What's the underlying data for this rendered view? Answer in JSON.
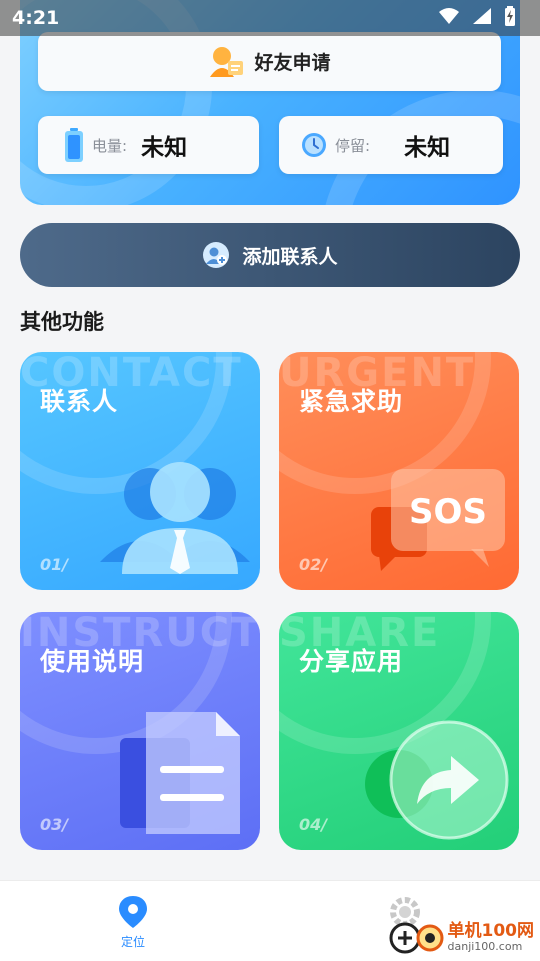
{
  "status_bar": {
    "time": "4:21"
  },
  "hero": {
    "friend_request_label": "好友申请",
    "battery": {
      "label": "电量:",
      "value": "未知"
    },
    "stay": {
      "label": "停留:",
      "value": "未知"
    }
  },
  "add_contact_label": "添加联系人",
  "section_title": "其他功能",
  "features": [
    {
      "title": "联系人",
      "en": "CONTACT",
      "num": "01/"
    },
    {
      "title": "紧急求助",
      "en": "URGENT",
      "num": "02/",
      "badge": "SOS"
    },
    {
      "title": "使用说明",
      "en": "INSTRUCTION",
      "num": "03/"
    },
    {
      "title": "分享应用",
      "en": "SHARE",
      "num": "04/"
    }
  ],
  "nav": {
    "locate_label": "定位"
  },
  "watermark": {
    "cn": "单机100网",
    "en": "danji100.com"
  },
  "colors": {
    "primary": "#2f93ff",
    "orange": "#ff6a33",
    "purple": "#5d6ff5",
    "green": "#23cf78",
    "dark_button": "#2c4460"
  }
}
